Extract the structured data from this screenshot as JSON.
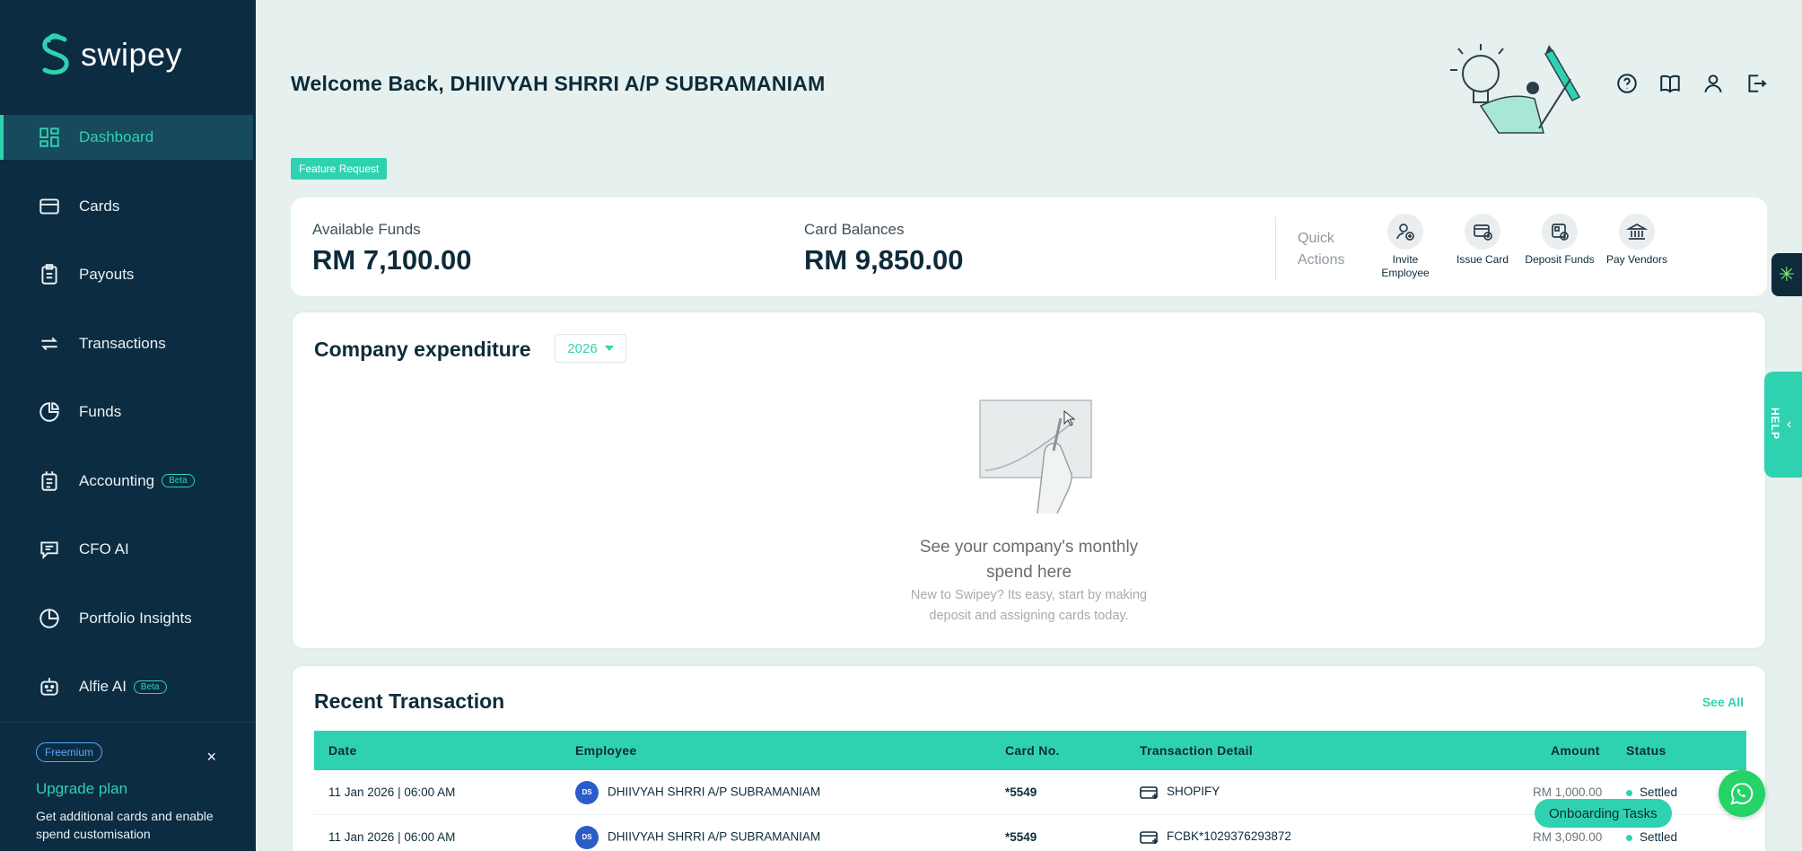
{
  "app": {
    "name": "swipey"
  },
  "sidebar": {
    "items": [
      {
        "label": "Dashboard",
        "icon": "dashboard-icon",
        "active": true
      },
      {
        "label": "Cards",
        "icon": "card-icon"
      },
      {
        "label": "Payouts",
        "icon": "clipboard-icon"
      },
      {
        "label": "Transactions",
        "icon": "exchange-icon"
      },
      {
        "label": "Funds",
        "icon": "pie-chart-icon"
      },
      {
        "label": "Accounting",
        "icon": "ledger-icon",
        "badge": "Beta"
      },
      {
        "label": "CFO AI",
        "icon": "chat-icon"
      },
      {
        "label": "Portfolio Insights",
        "icon": "insights-icon"
      },
      {
        "label": "Alfie AI",
        "icon": "robot-icon",
        "badge": "Beta"
      }
    ],
    "upgrade": {
      "plan_badge": "Freemium",
      "close": "×",
      "title": "Upgrade plan",
      "description": "Get additional cards and enable spend customisation"
    }
  },
  "header": {
    "welcome": "Welcome Back, DHIIVYAH SHRRI A/P SUBRAMANIAM",
    "icons": [
      "help-icon",
      "book-icon",
      "user-icon",
      "logout-icon"
    ],
    "feature_request": "Feature Request"
  },
  "funds": {
    "available_label": "Available Funds",
    "available_value": "RM 7,100.00",
    "balances_label": "Card Balances",
    "balances_value": "RM 9,850.00",
    "quick_actions_label": "Quick Actions",
    "quick_actions": [
      {
        "label": "Invite Employee",
        "icon": "invite-employee-icon"
      },
      {
        "label": "Issue Card",
        "icon": "issue-card-icon"
      },
      {
        "label": "Deposit Funds",
        "icon": "deposit-funds-icon"
      },
      {
        "label": "Pay Vendors",
        "icon": "bank-icon"
      }
    ]
  },
  "expenditure": {
    "title": "Company expenditure",
    "year": "2026",
    "empty_title": "See your company's monthly spend here",
    "empty_desc": "New to Swipey? Its easy, start by making deposit and assigning cards today."
  },
  "transactions": {
    "title": "Recent Transaction",
    "see_all": "See All",
    "columns": [
      "Date",
      "Employee",
      "Card No.",
      "Transaction Detail",
      "Amount",
      "Status"
    ],
    "rows": [
      {
        "date": "11 Jan 2026 | 06:00 AM",
        "initials": "DS",
        "employee": "DHIIVYAH SHRRI A/P SUBRAMANIAM",
        "card": "*5549",
        "detail": "SHOPIFY",
        "amount": "RM 1,000.00",
        "status": "Settled"
      },
      {
        "date": "11 Jan 2026 | 06:00 AM",
        "initials": "DS",
        "employee": "DHIIVYAH SHRRI A/P SUBRAMANIAM",
        "card": "*5549",
        "detail": "FCBK*1029376293872",
        "amount": "RM 3,090.00",
        "status": "Settled"
      }
    ]
  },
  "floating": {
    "help": "HELP",
    "onboarding": "Onboarding Tasks"
  },
  "colors": {
    "sidebar_bg": "#0c2c42",
    "accent": "#2fd2b0",
    "page_bg": "#e6f0ee"
  }
}
